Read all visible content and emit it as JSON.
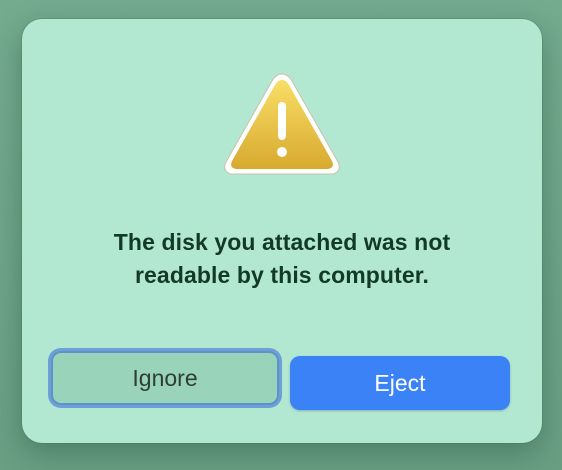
{
  "alert": {
    "icon": "warning-triangle-icon",
    "message_line1": "The disk you attached was not",
    "message_line2": "readable by this computer.",
    "buttons": {
      "ignore_label": "Ignore",
      "eject_label": "Eject"
    }
  },
  "colors": {
    "dialog_background": "#b2e8d2",
    "accent": "#3a82f6",
    "focus_ring": "#6e9fd6",
    "warning_yellow": "#f0c83c"
  }
}
